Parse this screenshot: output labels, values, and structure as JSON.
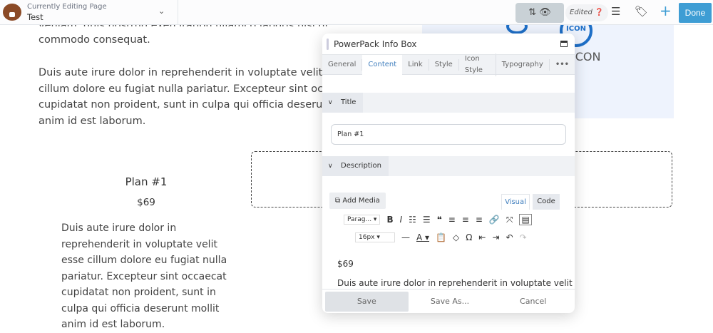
{
  "topbar": {
    "subtitle": "Currently Editing Page",
    "page": "Test",
    "edited": "Edited",
    "done": "Done"
  },
  "content": {
    "line0": "veniam, quis nostrud exercitation ullamco laboris nisi ut aliquip ex ea",
    "line1": "commodo consequat.",
    "para2": "Duis aute irure dolor in reprehenderit in voluptate velit esse cillum dolore eu fugiat nulla pariatur. Excepteur sint occaecat cupidatat non proident, sunt in culpa qui officia deserunt mollit anim id est laborum.",
    "icon_text": "ICON",
    "icon_label": "ICON",
    "plan_title": "Plan #1",
    "plan_price": "$69",
    "plan_desc": "Duis aute irure dolor in reprehenderit in voluptate velit esse cillum dolore eu fugiat nulla pariatur. Excepteur sint occaecat cupidatat non proident, sunt in culpa qui officia deserunt mollit anim id est laborum."
  },
  "panel": {
    "title": "PowerPack Info Box",
    "tabs": [
      "General",
      "Content",
      "Link",
      "Style",
      "Icon Style",
      "Typography"
    ],
    "more": "•••",
    "title_section": "Title",
    "title_value": "Plan #1",
    "desc_section": "Description",
    "add_media": "Add Media",
    "visual": "Visual",
    "code": "Code",
    "format": "Parag...",
    "font_size": "16px",
    "editor_price": "$69",
    "editor_text": "Duis aute irure dolor in reprehenderit in voluptate velit",
    "save": "Save",
    "save_as": "Save As...",
    "cancel": "Cancel"
  }
}
